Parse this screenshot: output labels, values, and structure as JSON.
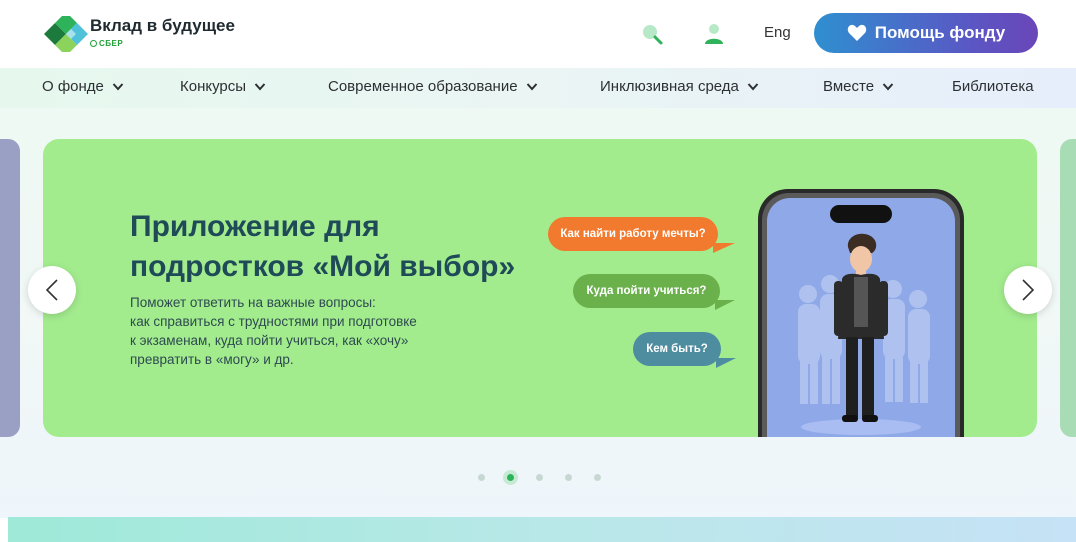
{
  "header": {
    "logo": {
      "title": "Вклад в будущее",
      "subtitle": "СБЕР"
    },
    "lang_label": "Eng",
    "donate_label": "Помощь фонду",
    "icons": [
      "search-icon",
      "user-icon",
      "heart-icon"
    ]
  },
  "nav": {
    "items": [
      {
        "label": "О фонде",
        "has_dropdown": true
      },
      {
        "label": "Конкурсы",
        "has_dropdown": true
      },
      {
        "label": "Современное образование",
        "has_dropdown": true
      },
      {
        "label": "Инклюзивная среда",
        "has_dropdown": true
      },
      {
        "label": "Вместе",
        "has_dropdown": true
      },
      {
        "label": "Библиотека",
        "has_dropdown": false
      }
    ]
  },
  "hero": {
    "title_line1": "Приложение для",
    "title_line2": "подростков «Мой выбор»",
    "desc_lines": [
      "Поможет ответить на важные вопросы:",
      "как справиться с трудностями при подготовке",
      "к экзаменам, куда пойти учиться, как «хочу»",
      "превратить в «могу» и др."
    ],
    "bubbles": [
      "Как найти работу мечты?",
      "Куда пойти учиться?",
      "Кем быть?"
    ]
  },
  "carousel": {
    "total_slides": 5,
    "active_index": 1
  },
  "colors": {
    "slide_bg": "#a3ec8e",
    "title": "#1f4a57",
    "accent_green": "#2eb35a",
    "donate_start": "#2f8fd0",
    "donate_end": "#6a46b8",
    "bubble_orange": "#f27a2e",
    "bubble_green": "#6ab14c",
    "bubble_teal": "#4e8ca0"
  }
}
